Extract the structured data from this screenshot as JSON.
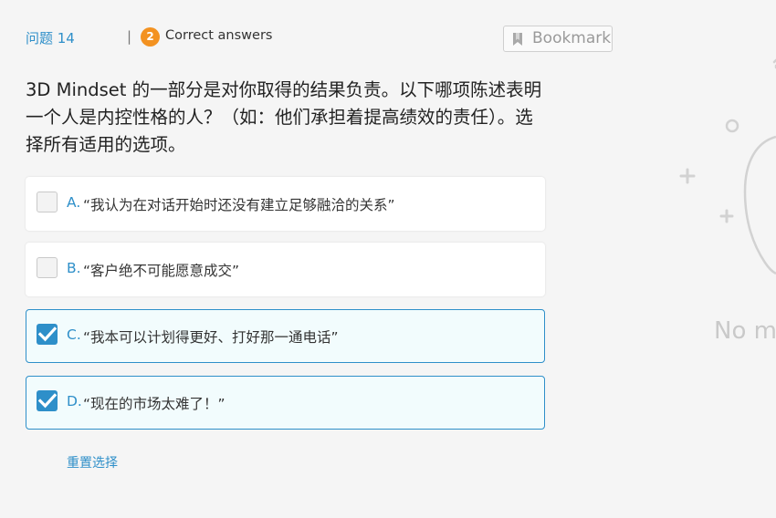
{
  "header": {
    "question_number": "问题 14",
    "separator": "|",
    "correct_count": "2",
    "correct_label": "Correct answers",
    "bookmark_label": "Bookmark"
  },
  "question": {
    "text": "3D Mindset 的一部分是对你取得的结果负责。以下哪项陈述表明一个人是内控性格的人？（如：他们承担着提高绩效的责任）。选择所有适用的选项。"
  },
  "options": [
    {
      "letter": "A.",
      "text": "“我认为在对话开始时还没有建立足够融洽的关系”",
      "checked": false
    },
    {
      "letter": "B.",
      "text": "“客户绝不可能愿意成交”",
      "checked": false
    },
    {
      "letter": "C.",
      "text": "“我本可以计划得更好、打好那一通电话”",
      "checked": true
    },
    {
      "letter": "D.",
      "text": "“现在的市场太难了！”",
      "checked": true
    }
  ],
  "reset_label": "重置选择",
  "side_panel": {
    "empty_text": "No mo"
  },
  "colors": {
    "accent_blue": "#2e8fc9",
    "badge_orange": "#f39221",
    "background": "#f5f5f5"
  },
  "icons": {
    "bookmark": "bookmark-icon",
    "checkbox_checked": "checkmark-icon"
  }
}
